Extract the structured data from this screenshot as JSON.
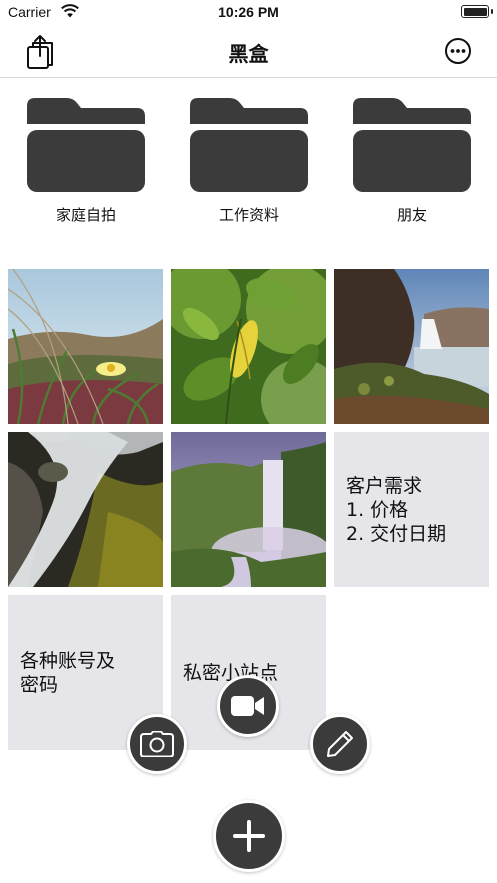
{
  "status_bar": {
    "carrier": "Carrier",
    "time": "10:26 PM",
    "battery_level": 1.0
  },
  "nav": {
    "title": "黑盒",
    "left_icon": "share-icon",
    "right_icon": "more-icon"
  },
  "folders": [
    {
      "label": "家庭自拍",
      "icon": "folder-icon"
    },
    {
      "label": "工作资料",
      "icon": "folder-icon"
    },
    {
      "label": "朋友",
      "icon": "folder-icon"
    }
  ],
  "photos": [
    {
      "subject": "yellow flower in grass"
    },
    {
      "subject": "green leaves"
    },
    {
      "subject": "waterfall by sea cliff"
    },
    {
      "subject": "long exposure stream over mossy rocks"
    },
    {
      "subject": "tall waterfall in misty valley"
    }
  ],
  "notes": [
    {
      "text": "客户需求\n1. 价格\n2. 交付日期"
    },
    {
      "text": "各种账号及\n密码"
    },
    {
      "text": "私密小站点"
    }
  ],
  "actions": {
    "camera": "camera-icon",
    "video": "video-camera-icon",
    "edit": "pencil-icon",
    "add": "plus-icon"
  },
  "colors": {
    "icon_dark": "#3b3b3b",
    "note_bg": "#e6e6ea"
  }
}
